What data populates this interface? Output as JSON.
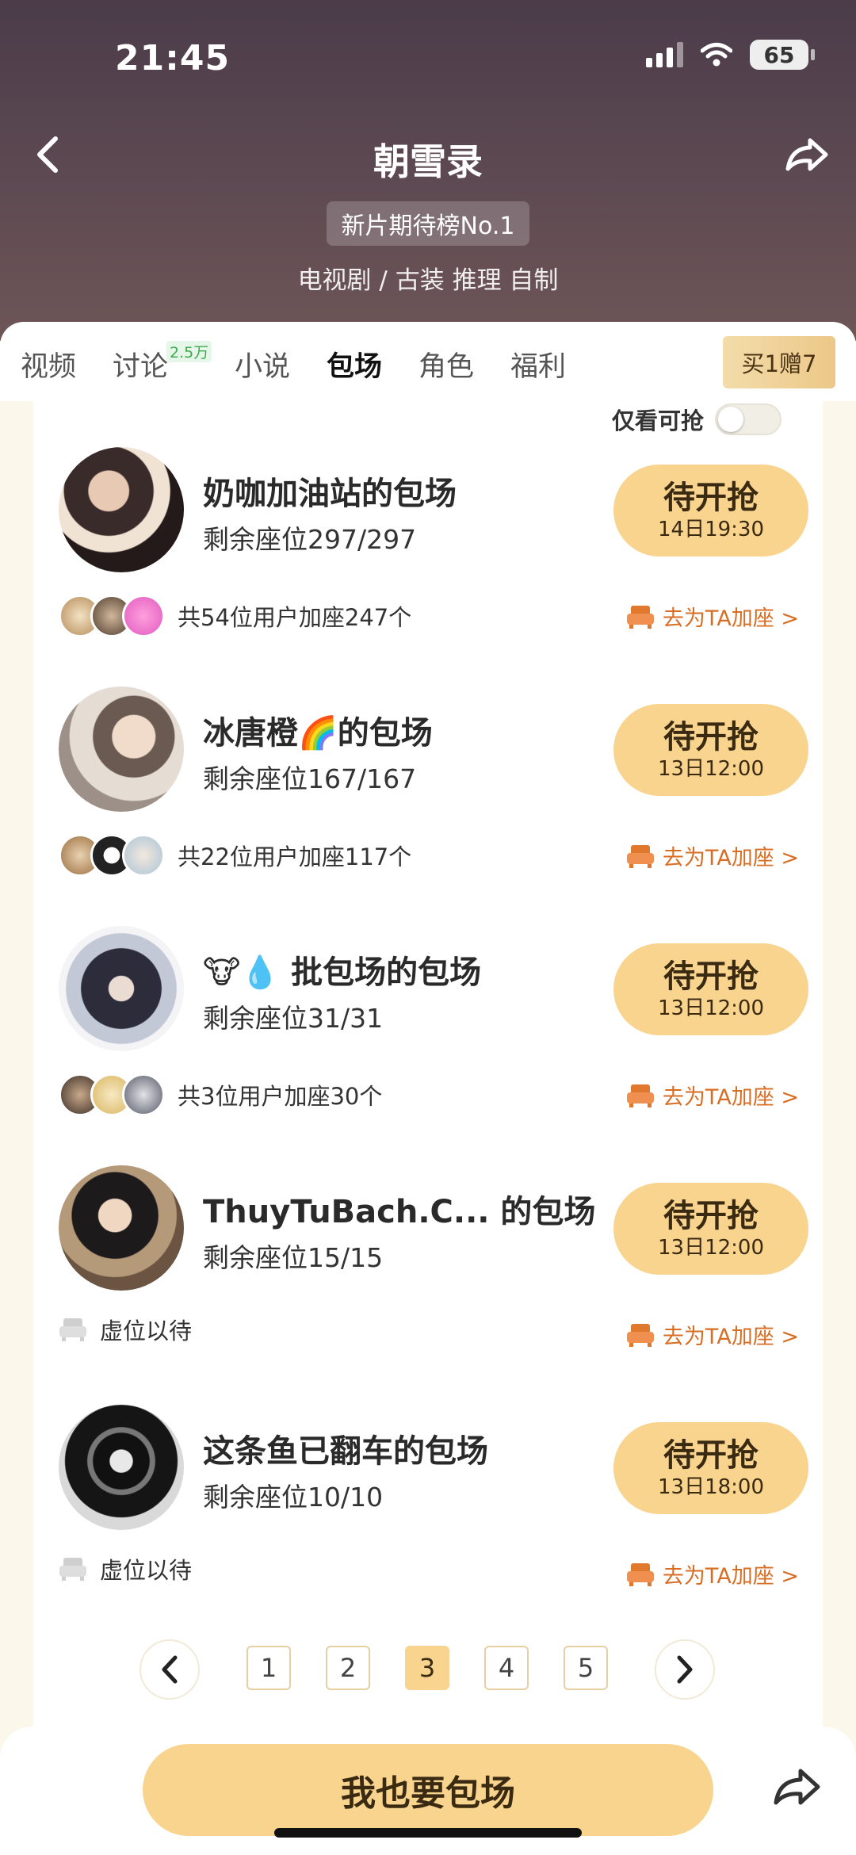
{
  "status_bar": {
    "time": "21:45",
    "battery": "65"
  },
  "header": {
    "title": "朝雪录",
    "rank_badge": "新片期待榜No.1",
    "genre": "电视剧 / 古装 推理 自制"
  },
  "tabs": [
    {
      "label": "视频"
    },
    {
      "label": "讨论",
      "badge": "2.5万"
    },
    {
      "label": "小说"
    },
    {
      "label": "包场",
      "active": true
    },
    {
      "label": "角色"
    },
    {
      "label": "福利"
    }
  ],
  "buy_button": "买1赠7",
  "filter": {
    "label": "仅看可抢",
    "on": false
  },
  "cards": [
    {
      "title": "奶咖加油站的包场",
      "seats": "剩余座位297/297",
      "btn_main": "待开抢",
      "btn_time": "14日19:30",
      "footer": "共54位用户加座247个",
      "link": "去为TA加座 >"
    },
    {
      "title": "冰唐橙🌈的包场",
      "seats": "剩余座位167/167",
      "btn_main": "待开抢",
      "btn_time": "13日12:00",
      "footer": "共22位用户加座117个",
      "link": "去为TA加座 >"
    },
    {
      "title": "🐮💧 批包场的包场",
      "seats": "剩余座位31/31",
      "btn_main": "待开抢",
      "btn_time": "13日12:00",
      "footer": "共3位用户加座30个",
      "link": "去为TA加座 >"
    },
    {
      "title": "ThuyTuBach.C... 的包场",
      "seats": "剩余座位15/15",
      "btn_main": "待开抢",
      "btn_time": "13日12:00",
      "footer": "虚位以待",
      "link": "去为TA加座 >"
    },
    {
      "title": "这条鱼已翻车的包场",
      "seats": "剩余座位10/10",
      "btn_main": "待开抢",
      "btn_time": "13日18:00",
      "footer": "虚位以待",
      "link": "去为TA加座 >"
    }
  ],
  "pagination": {
    "pages": [
      "1",
      "2",
      "3",
      "4",
      "5"
    ],
    "current": "3"
  },
  "cta": "我也要包场"
}
